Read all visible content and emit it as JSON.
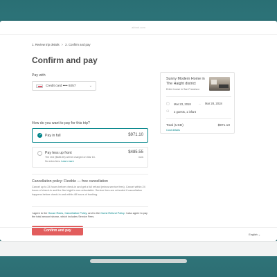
{
  "window": {
    "url": "airbnb.com"
  },
  "breadcrumb": {
    "step1": "1. Review trip details",
    "separator": ">",
    "step2": "2. Confirm and pay"
  },
  "page": {
    "title": "Confirm and pay"
  },
  "payment": {
    "label": "Pay with",
    "card_text": "Credit card •••• 9257",
    "card_icon": "visa-icon"
  },
  "options": {
    "label": "How do you want to pay for this trip?",
    "full": {
      "title": "Pay in full",
      "price": "$971.10",
      "selected": true
    },
    "split": {
      "title": "Pay less up front",
      "price": "$485.55",
      "price_note": "now",
      "desc_line1": "The rest ($485.55) will be charged on Mar 15.",
      "desc_line2": "No extra fees.",
      "learn_more": "Learn more"
    }
  },
  "policy": {
    "title": "Cancellation policy: Flexible — free cancellation",
    "text": "Cancel up to 24 hours before check-in and get a full refund (minus service fees). Cancel within 24 hours of check-in and the first night is non-refundable. Service fees are refunded if cancellation happens before check-in and within 48 hours of booking."
  },
  "agreement": {
    "prefix": "I agree to the ",
    "house_rules": "House Rules",
    "sep1": ", ",
    "cancellation_policy": "Cancellation Policy",
    "sep2": ", and to the ",
    "guest_refund": "Guest Refund Policy",
    "suffix": ". I also agree to pay the total amount shown, which includes Service Fees."
  },
  "confirm_button": "Confirm and pay",
  "summary": {
    "listing_title": "Sunny Modern Home in The Haight district",
    "listing_sub": "Entire house in San Francisco",
    "date_start": "Mar 23, 2018",
    "arrow": "→",
    "date_end": "Mar 28, 2018",
    "guests": "2 guests, 1 infant",
    "total_label": "Total (USD)",
    "total_value": "$971.10",
    "details_link": "Cost details"
  },
  "footer": {
    "language": "English"
  },
  "colors": {
    "accent": "#008489",
    "button": "#e25d5d",
    "background": "#3f8d92"
  }
}
